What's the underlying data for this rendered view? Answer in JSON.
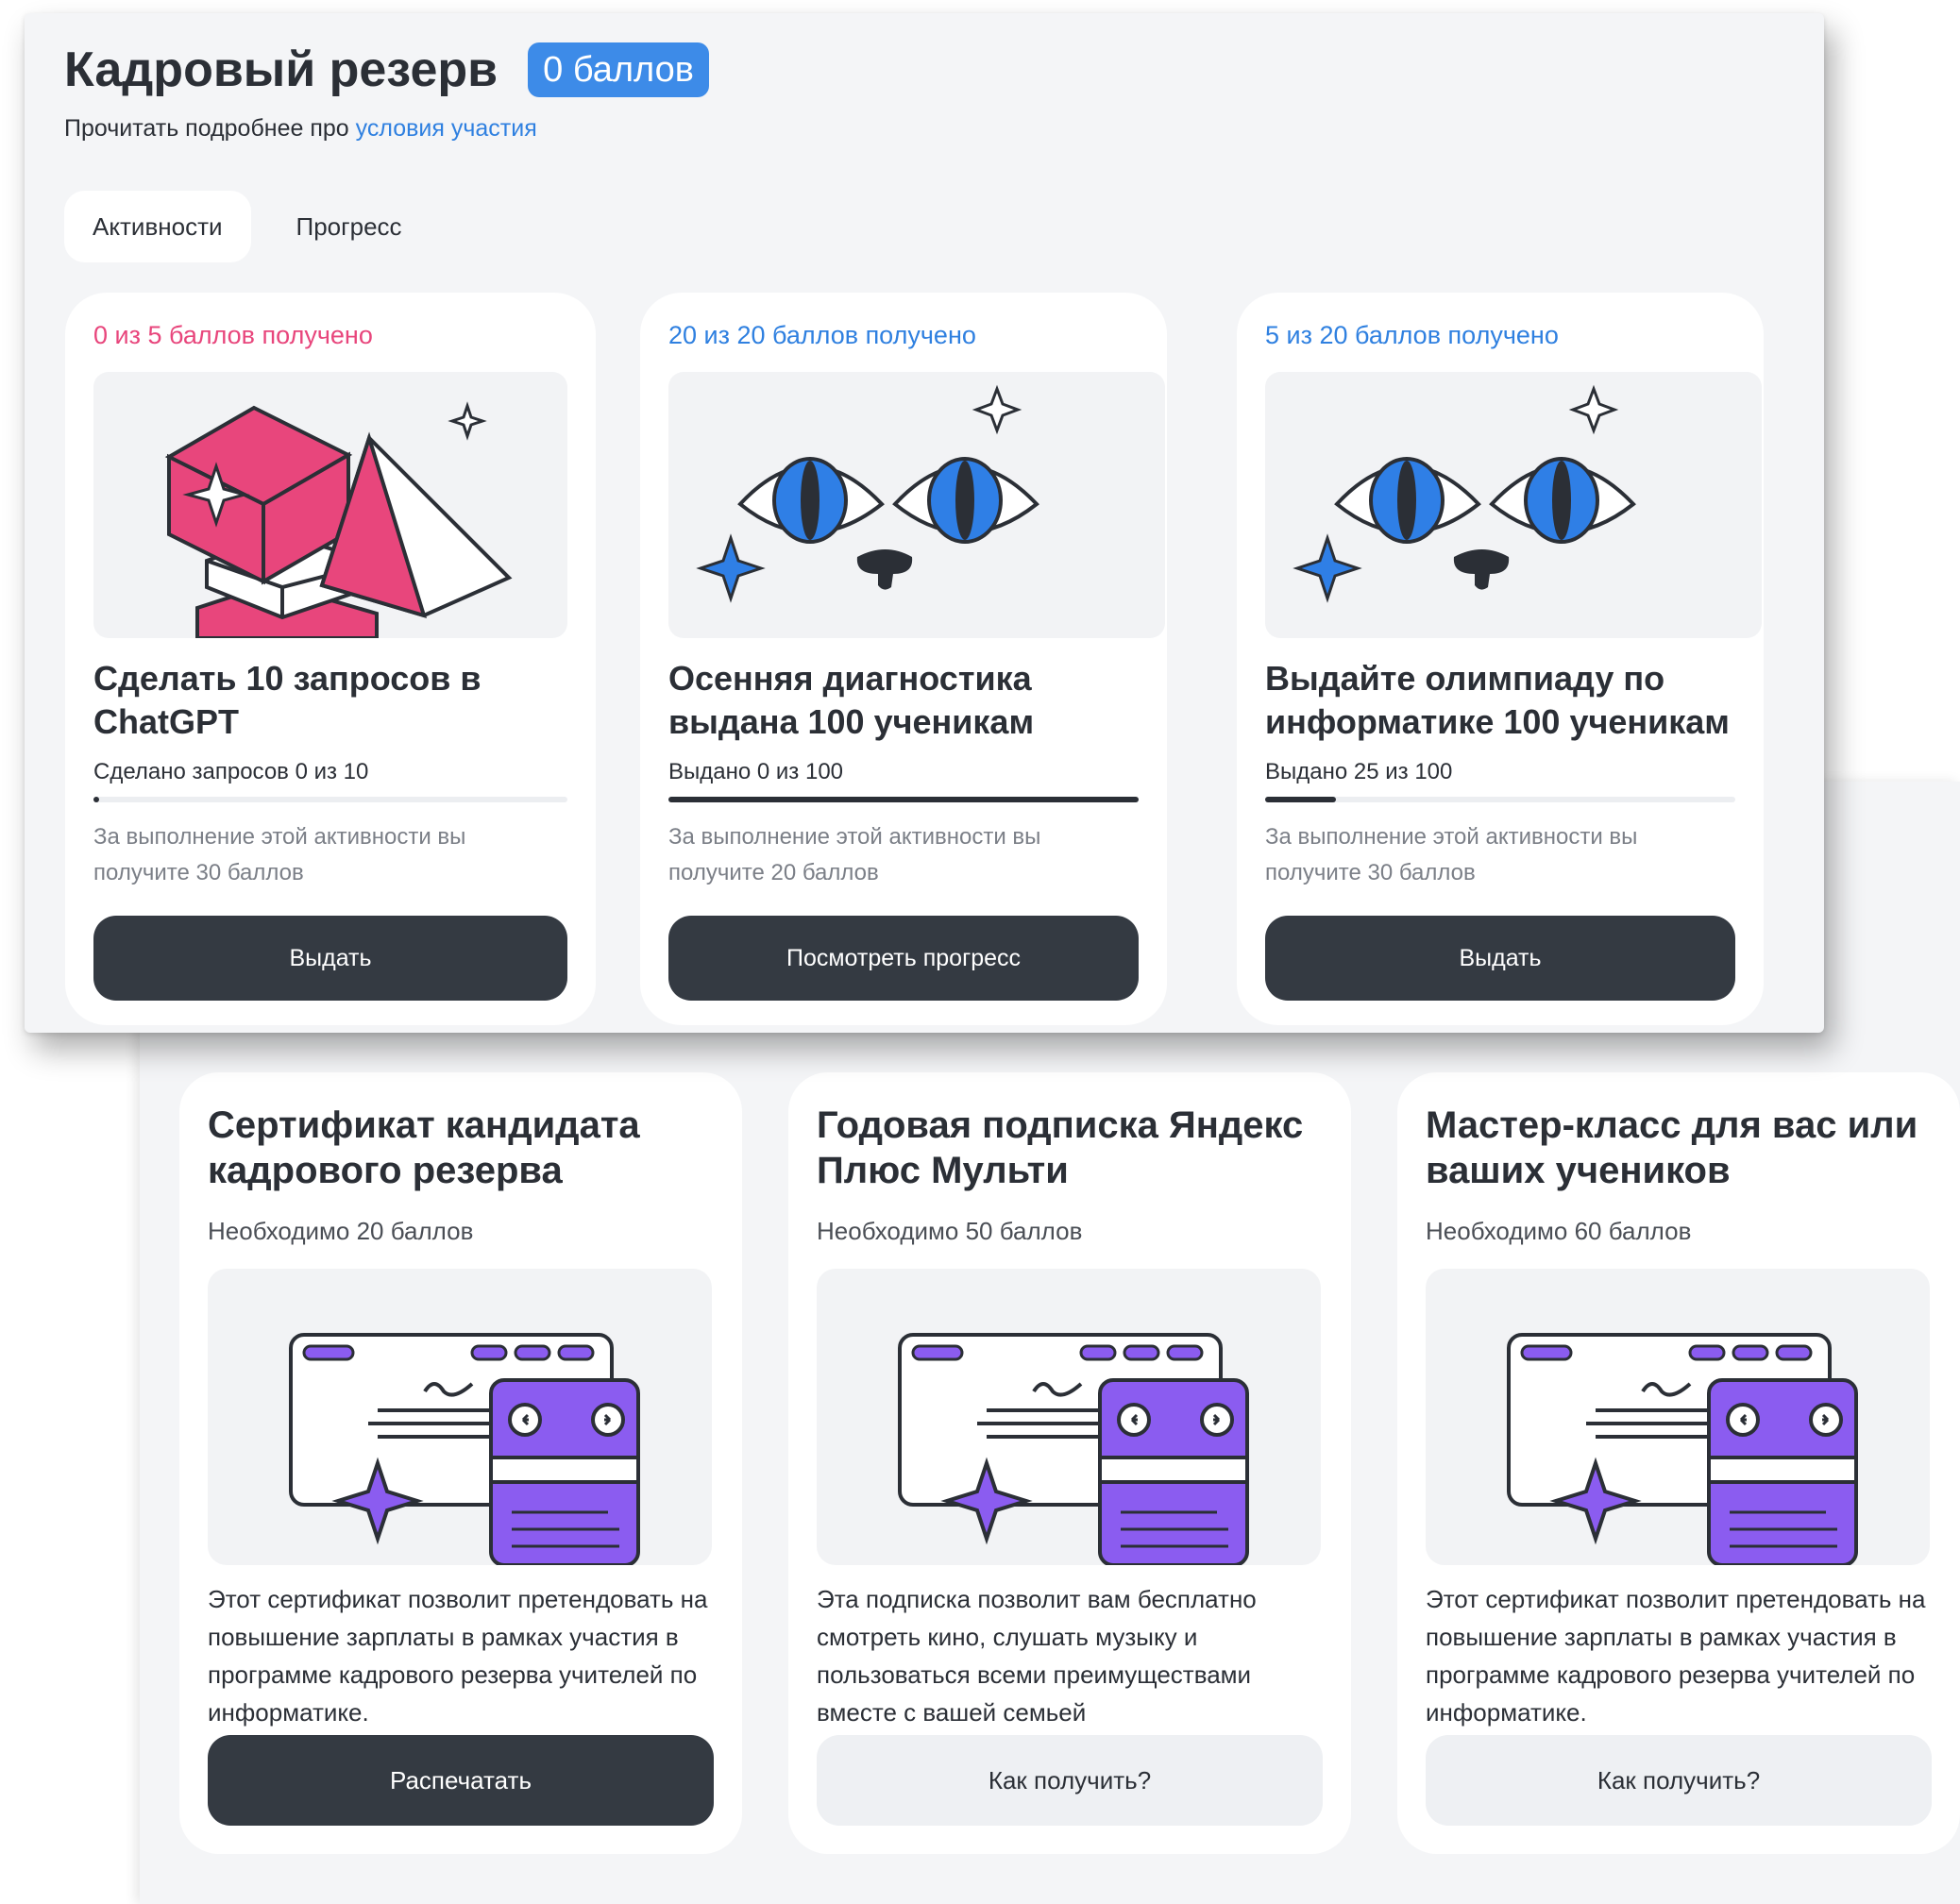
{
  "header": {
    "title": "Кадровый резерв",
    "points_badge": "0 баллов",
    "subtitle_prefix": "Прочитать подробнее про ",
    "subtitle_link": "условия участия"
  },
  "tabs": [
    {
      "label": "Активности",
      "active": true
    },
    {
      "label": "Прогресс",
      "active": false
    }
  ],
  "activities": [
    {
      "points_text": "0 из 5 баллов получено",
      "points_color": "#e8467c",
      "illustration": "pink-cubes-pyramid-illustration",
      "title": "Сделать 10 запросов в ChatGPT",
      "progress_label": "Сделано запросов 0 из 10",
      "progress_fraction": 0.0,
      "note": "За выполнение этой активности вы получите 30 баллов",
      "button": "Выдать"
    },
    {
      "points_text": "20 из 20 баллов получено",
      "points_color": "#2f80e0",
      "illustration": "cat-eyes-illustration",
      "title": "Осенняя диагностика выдана 100 ученикам",
      "progress_label": "Выдано 0 из 100",
      "progress_fraction": 1.0,
      "note": "За выполнение этой активности вы получите 20 баллов",
      "button": "Посмотреть прогресс"
    },
    {
      "points_text": "5 из 20 баллов получено",
      "points_color": "#2f80e0",
      "illustration": "cat-eyes-illustration",
      "title": "Выдайте олимпиаду по информатике 100 ученикам",
      "progress_label": "Выдано 25 из 100",
      "progress_fraction": 0.15,
      "note": "За выполнение этой активности вы получите 30 баллов",
      "button": "Выдать"
    }
  ],
  "rewards": [
    {
      "title": "Сертификат кандидата кадрового резерва",
      "need": "Необходимо 20 баллов",
      "illustration": "certificate-window-illustration",
      "description": "Этот сертификат позволит претендовать на повышение зарплаты в рамках участия в программе кадрового резерва учителей по информатике.",
      "button": "Распечатать",
      "button_style": "dark"
    },
    {
      "title": "Годовая подписка Яндекс Плюс Мульти",
      "need": "Необходимо 50 баллов",
      "illustration": "certificate-window-illustration",
      "description": "Эта подписка позволит вам бесплатно смотреть кино, слушать музыку и пользоваться всеми преимуществами вместе с вашей семьей",
      "button": "Как получить?",
      "button_style": "light"
    },
    {
      "title": "Мастер-класс для вас или ваших учеников",
      "need": "Необходимо 60 баллов",
      "illustration": "certificate-window-illustration",
      "description": "Этот сертификат позволит претендовать на повышение зарплаты в рамках участия в программе кадрового резерва учителей по информатике.",
      "button": "Как получить?",
      "button_style": "light"
    }
  ],
  "colors": {
    "accent_blue": "#3d8be8",
    "link_blue": "#2f80e0",
    "pink": "#e8467c",
    "purple": "#8b5cf0",
    "dark_button": "#343a42"
  }
}
